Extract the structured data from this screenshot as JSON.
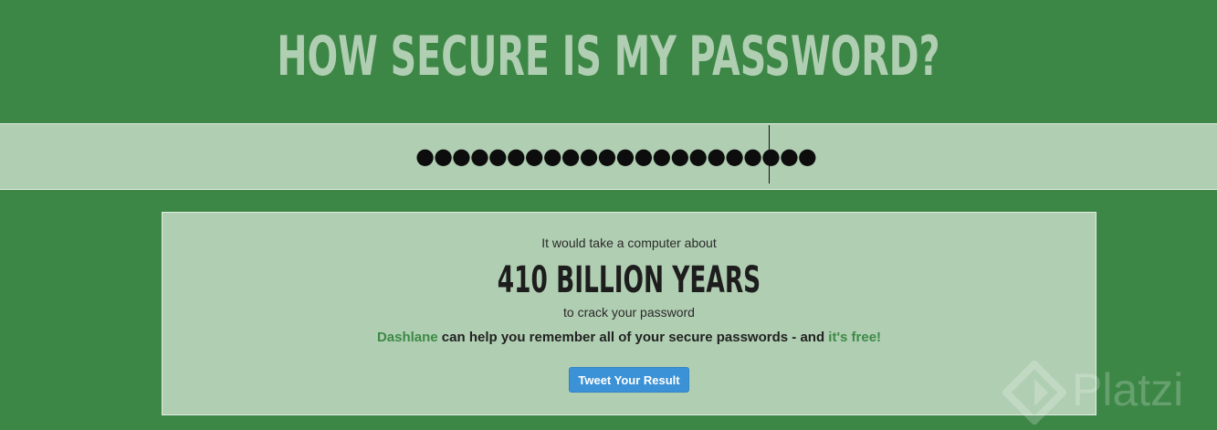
{
  "header": {
    "title": "HOW SECURE IS MY PASSWORD?"
  },
  "password_field": {
    "value": "●●●●●●●●●●●●●●●●●●●●●●"
  },
  "result": {
    "lead_text": "It would take a computer about",
    "duration": "410 BILLION YEARS",
    "tail_text": "to crack your password",
    "promo": {
      "brand": "Dashlane",
      "middle": " can help you remember all of your secure passwords - and ",
      "free": "it's free!"
    },
    "tweet_button": "Tweet Your Result"
  },
  "watermark": {
    "text": "Platzi",
    "icon": "platzi-logo-icon"
  },
  "colors": {
    "background": "#3c8646",
    "panel": "#b0ceb2",
    "accent": "#3d8a46",
    "button": "#3b92d6"
  }
}
